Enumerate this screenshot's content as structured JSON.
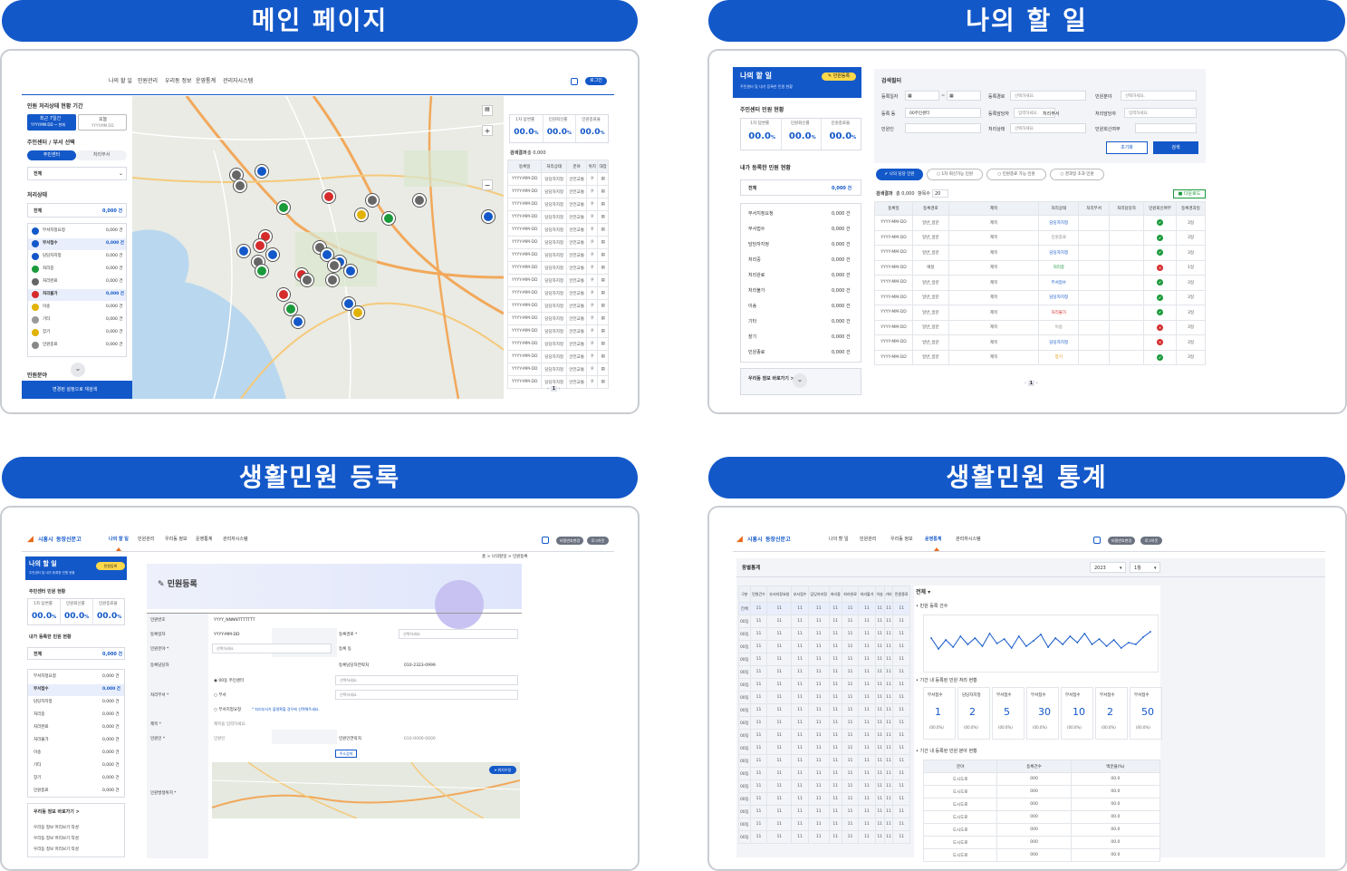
{
  "panels": {
    "main": {
      "title": "메인 페이지"
    },
    "todo": {
      "title": "나의 할 일"
    },
    "register": {
      "title": "생활민원 등록"
    },
    "stats": {
      "title": "생활민원 통계"
    }
  },
  "nav": [
    "나의 할 일",
    "민원관리",
    "우리동 정보",
    "운영통계",
    "관리자시스템"
  ],
  "brand": {
    "city": "시흥시",
    "name": "동장신문고"
  },
  "header_buttons": {
    "login": "로그인",
    "change_pw": "비밀번호변경",
    "logout": "로그아웃"
  },
  "main": {
    "period_title": "민원 처리상태 현황 기간",
    "period_btn1": "최근 7일간",
    "period_btn1_sub": "YYYY.MM.DD ~ 현재",
    "period_btn2": "오늘",
    "period_btn2_sub": "YYYY.MM.DD",
    "center_title": "주민센터 / 부서 선택",
    "tab_center": "주민센터",
    "tab_dept": "처리부서",
    "select_all": "전체",
    "status_title": "처리상태",
    "total_label": "전체",
    "total_value": "0,000 건",
    "statuses": [
      {
        "label": "부서지정요청",
        "value": "0,000 건",
        "color": "#1358c9"
      },
      {
        "label": "부서접수",
        "value": "0,000 건",
        "color": "#1358c9"
      },
      {
        "label": "담당자지정",
        "value": "0,000 건",
        "color": "#1358c9"
      },
      {
        "label": "처리중",
        "value": "0,000 건",
        "color": "#1a9a3a"
      },
      {
        "label": "처리완료",
        "value": "0,000 건",
        "color": "#666666"
      },
      {
        "label": "처리불가",
        "value": "0,000 건",
        "color": "#d62b2b"
      },
      {
        "label": "이송",
        "value": "0,000 건",
        "color": "#e2b200"
      },
      {
        "label": "기타",
        "value": "0,000 건",
        "color": "#999999"
      },
      {
        "label": "장기",
        "value": "0,000 건",
        "color": "#e2b200"
      },
      {
        "label": "민원종료",
        "value": "0,000 건",
        "color": "#888888"
      }
    ],
    "field_title": "민원분야",
    "footer_btn": "변경된 설정으로 재검색",
    "metrics": [
      {
        "label": "1차 답변률",
        "value": "00.0",
        "unit": "%"
      },
      {
        "label": "민원회신률",
        "value": "00.0",
        "unit": "%"
      },
      {
        "label": "민원종료율",
        "value": "00.0",
        "unit": "%"
      }
    ],
    "result_label": "검색결과",
    "result_count": "총 0,000",
    "table_headers": [
      "등록일",
      "처리상태",
      "분야",
      "위치",
      "대장"
    ],
    "row": {
      "date": "YYYY-MM-DD",
      "status": "담당자지정",
      "field": "안전교통"
    },
    "pager": "1"
  },
  "todo": {
    "title": "나의 할 일",
    "sub": "주민센터 및 내가 등록한 민원 현황",
    "reg_btn": "민원등록",
    "center_title": "주민센터 민원 현황",
    "mine_title": "내가 등록한 민원 현황",
    "total_label": "전체",
    "total_value": "0,000 건",
    "statuses": [
      "부서지정요청",
      "부서접수",
      "담당자지정",
      "처리중",
      "처리완료",
      "처리불가",
      "이송",
      "기타",
      "장기",
      "민원종료"
    ],
    "status_value": "0,000 건",
    "goto": "우리동 정보 바로가기 >",
    "filter_title": "검색필터",
    "f_regdate": "등록일자",
    "f_route": "등록경로",
    "f_field": "민원분야",
    "f_select": "선택하세요.",
    "f_regdept": "등록 동",
    "f_regdept_val": "00주민센터",
    "f_regman": "등록담당자",
    "f_input": "입력하세요.",
    "f_procdept": "처리부서",
    "f_procman": "처리담당자",
    "f_person": "민원인",
    "f_state": "처리상태",
    "f_reply": "민원회신여부",
    "btn_reset": "초기화",
    "btn_search": "검색",
    "chips": [
      "나의 담당 민원",
      "1차 회신가능 민원",
      "민원종료 가능 민원",
      "경과일 초과 민원"
    ],
    "result": "검색결과",
    "result_count": "총 0,000",
    "per": "항목수",
    "per_val": "20",
    "download": "다운로드",
    "headers": [
      "등록일",
      "등록경로",
      "제목",
      "처리상태",
      "처리부서",
      "처리담당자",
      "민원회신여부",
      "등록경과일"
    ],
    "rows": [
      {
        "date": "YYYY-MM-DD",
        "route": "일반_방문",
        "title": "제목",
        "state": "담당자지정",
        "ok": true,
        "days": "3일",
        "sc": "#1358c9"
      },
      {
        "date": "YYYY-MM-DD",
        "route": "일반_방문",
        "title": "제목",
        "state": "민원종료",
        "ok": true,
        "days": "3일",
        "sc": "#888"
      },
      {
        "date": "YYYY-MM-DD",
        "route": "일반_방문",
        "title": "제목",
        "state": "담당자지정",
        "ok": true,
        "days": "3일",
        "sc": "#1358c9"
      },
      {
        "date": "YYYY-MM-DD",
        "route": "예찰",
        "title": "제목",
        "state": "처리중",
        "ok": false,
        "days": "1일",
        "sc": "#1a9a3a"
      },
      {
        "date": "YYYY-MM-DD",
        "route": "일반_방문",
        "title": "제목",
        "state": "부서접수",
        "ok": true,
        "days": "3일",
        "sc": "#1358c9"
      },
      {
        "date": "YYYY-MM-DD",
        "route": "일반_방문",
        "title": "제목",
        "state": "담당자지정",
        "ok": true,
        "days": "3일",
        "sc": "#1358c9"
      },
      {
        "date": "YYYY-MM-DD",
        "route": "일반_방문",
        "title": "제목",
        "state": "처리불가",
        "ok": true,
        "days": "3일",
        "sc": "#d62b2b"
      },
      {
        "date": "YYYY-MM-DD",
        "route": "일반_방문",
        "title": "제목",
        "state": "이송",
        "ok": false,
        "days": "3일",
        "sc": "#888"
      },
      {
        "date": "YYYY-MM-DD",
        "route": "일반_방문",
        "title": "제목",
        "state": "담당자지정",
        "ok": false,
        "days": "3일",
        "sc": "#1358c9"
      },
      {
        "date": "YYYY-MM-DD",
        "route": "일반_방문",
        "title": "제목",
        "state": "장기",
        "ok": true,
        "days": "3일",
        "sc": "#e29000"
      }
    ]
  },
  "register": {
    "breadcrumb": "홈 > 나의할일 > 민원등록",
    "page_title": "민원등록",
    "rows": {
      "no_label": "민원번호",
      "no_val": "YYYY_NNNNTTTTTTT",
      "date_label": "등록일자",
      "date_val": "YYYY-MM-DD",
      "route_label": "등록경로 *",
      "select": "선택하세요.",
      "field_label": "민원분야 *",
      "dong_label": "등록 동",
      "man_label": "등록담당자",
      "phone_label": "등록담당자연락처",
      "phone_val": "010-2323-0999",
      "dept_label": "처리부서 *",
      "opt1": "00동 주민센터",
      "opt2": "부서",
      "opt3": "부서지정요청",
      "opt3_note": "* 처리부서가 불명확할 경우에 선택해주세요.",
      "title_label": "제목 *",
      "title_ph": "제목을 입력하세요.",
      "person_label": "민원인 *",
      "person_ph": "민원인",
      "contact_label": "민원인연락처",
      "contact_ph": "010-0000-0000",
      "addr_btn": "주소검색",
      "loc_label": "민원발생위치 *",
      "loc_btn": "위치수정"
    },
    "goto_items": [
      "우리동 정보 머리보기 작성",
      "우리동 정보 머리보기 작성",
      "우리동 정보 머리보기 작성"
    ]
  },
  "stats": {
    "title": "동별통계",
    "year": "2023",
    "month": "1월",
    "headers": [
      "구분",
      "민원건수",
      "부서지정요청",
      "부서접수",
      "담당자지정",
      "처리중",
      "처리완료",
      "처리불가",
      "이송",
      "기타",
      "민원종료"
    ],
    "cell": "11",
    "dong": "00동",
    "total": "전체",
    "filter": "전체",
    "chart_title": "• 민원 등록 건수",
    "period_title": "• 기간 내 등록된 민원 처리 현황",
    "cards": [
      {
        "label": "부서접수",
        "value": "1",
        "pct": "(00.0%)"
      },
      {
        "label": "담당자지정",
        "value": "2",
        "pct": "(00.0%)"
      },
      {
        "label": "부서접수",
        "value": "5",
        "pct": "(00.0%)"
      },
      {
        "label": "부서접수",
        "value": "30",
        "pct": "(00.0%)"
      },
      {
        "label": "부서접수",
        "value": "10",
        "pct": "(00.0%)"
      },
      {
        "label": "부서접수",
        "value": "2",
        "pct": "(00.0%)"
      },
      {
        "label": "부서접수",
        "value": "50",
        "pct": "(00.0%)"
      }
    ],
    "field_title": "• 기간 내 등록된 민원 분야 현황",
    "field_headers": [
      "분야",
      "등록건수",
      "백분율(%)"
    ],
    "field_row": {
      "name": "도시도로",
      "count": "000",
      "pct": "00.0"
    }
  },
  "chart_data": {
    "type": "line",
    "x": [
      1,
      2,
      3,
      4,
      5,
      6,
      7,
      8,
      9,
      10,
      11,
      12,
      13,
      14,
      15,
      16,
      17,
      18,
      19,
      20,
      21,
      22,
      23,
      24,
      25,
      26,
      27,
      28,
      29,
      30,
      31
    ],
    "values": [
      62,
      38,
      58,
      42,
      66,
      48,
      62,
      44,
      72,
      50,
      60,
      40,
      66,
      44,
      56,
      70,
      42,
      62,
      48,
      66,
      52,
      72,
      48,
      60,
      44,
      58,
      40,
      52,
      48,
      64,
      76
    ]
  }
}
